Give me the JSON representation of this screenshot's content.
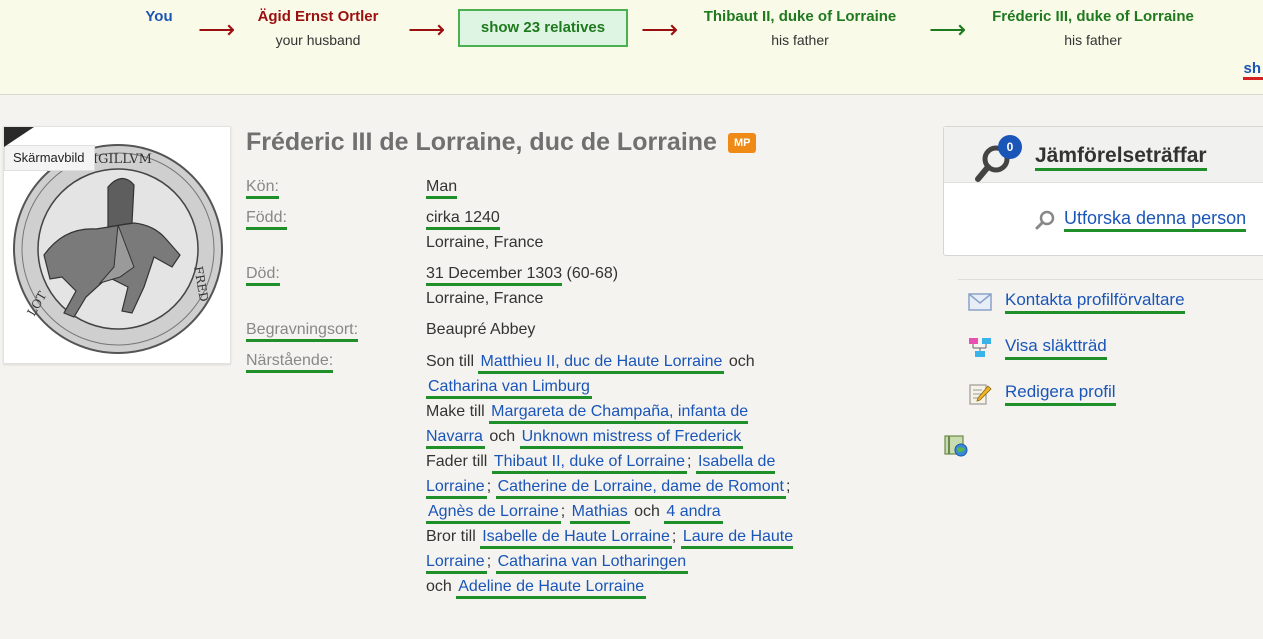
{
  "path": {
    "you": "You",
    "person1": {
      "name": "Ägid Ernst Ortler",
      "relation": "your husband"
    },
    "show_button": "show 23 relatives",
    "person2": {
      "name": "Thibaut II, duke of Lorraine",
      "relation": "his father"
    },
    "person3": {
      "name": "Fréderic III, duke of Lorraine",
      "relation": "his father"
    },
    "arrow": "⟶",
    "truncated_link": "sh"
  },
  "photo": {
    "tag": "Skärmavbild"
  },
  "profile": {
    "name": "Fréderic III de Lorraine, duc de Lorraine",
    "badge": "MP",
    "gender_label": "Kön:",
    "gender": "Man",
    "born_label": "Född:",
    "born_date": "cirka 1240",
    "born_place": "Lorraine, France",
    "died_label": "Död:",
    "died_date": "31 December 1303",
    "died_age": "(60-68)",
    "died_place": "Lorraine, France",
    "burial_label": "Begravningsort:",
    "burial": "Beaupré Abbey",
    "relatives_label": "Närstående:"
  },
  "relatives": {
    "son_of": "Son till",
    "father1": "Matthieu II, duc de Haute Lorraine",
    "and": "och",
    "mother": "Catharina van Limburg",
    "husband_of": "Make till",
    "wife1": "Margareta de Champaña, infanta de Navarra",
    "wife2": "Unknown mistress of Frederick",
    "father_of": "Fader till",
    "child1": "Thibaut II, duke of Lorraine",
    "child2": "Isabella de Lorraine",
    "child3": "Catherine de Lorraine, dame de Romont",
    "child4": "Agnès de Lorraine",
    "child5": "Mathias",
    "more": "4 andra",
    "brother_of": "Bror till",
    "sib1": "Isabelle de Haute Lorraine",
    "sib2": "Laure de Haute Lorraine",
    "sib3": "Catharina van Lotharingen",
    "sib4": "Adeline de Haute Lorraine",
    "sep": ";"
  },
  "sidebar": {
    "match_count": "0",
    "match_title": "Jämförelseträffar",
    "explore": "Utforska denna person",
    "contact": "Kontakta profilförvaltare",
    "tree": "Visa släktträd",
    "edit": "Redigera profil"
  },
  "colors": {
    "link": "#1a55b8",
    "underline": "#1f8f2a",
    "badge": "#ef8a16",
    "arrow_red": "#9b0f0f",
    "arrow_green": "#1f7a1f"
  }
}
